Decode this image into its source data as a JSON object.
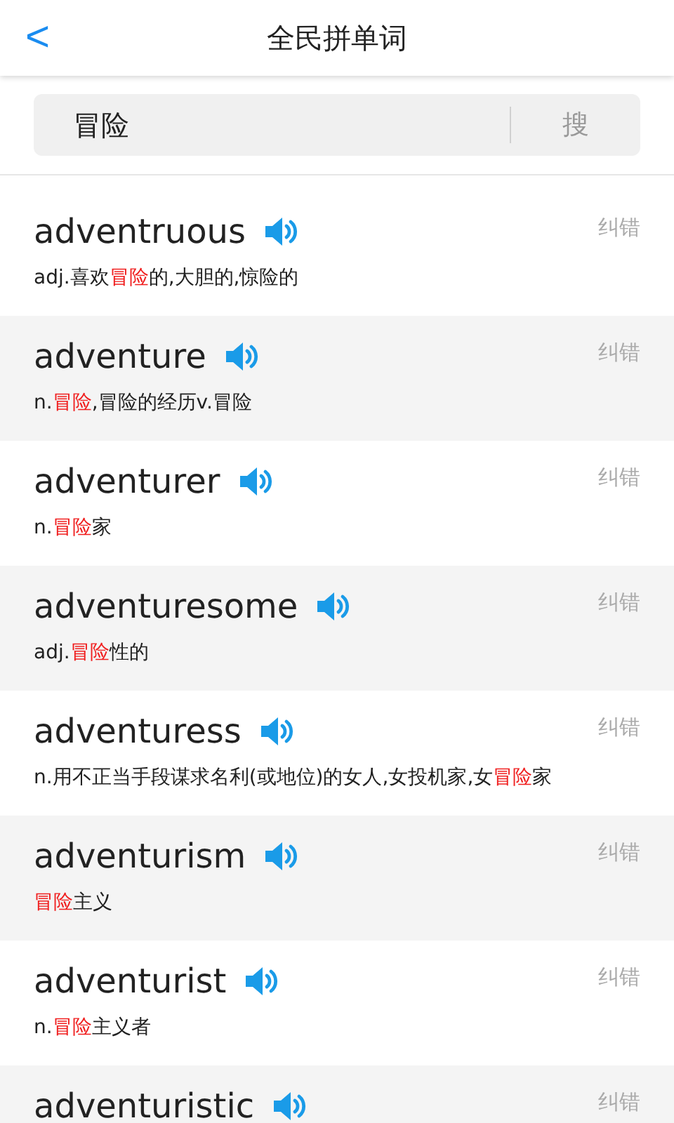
{
  "header": {
    "back": "<",
    "title": "全民拼单词"
  },
  "search": {
    "value": "冒险",
    "button": "搜"
  },
  "words": [
    {
      "word": "adventruous",
      "report": "纠错",
      "definition": [
        {
          "text": "adj.喜欢",
          "highlight": false
        },
        {
          "text": "冒险",
          "highlight": true
        },
        {
          "text": "的,大胆的,惊险的",
          "highlight": false
        }
      ]
    },
    {
      "word": "adventure",
      "report": "纠错",
      "definition": [
        {
          "text": "n.",
          "highlight": false
        },
        {
          "text": "冒险",
          "highlight": true
        },
        {
          "text": ",冒险的经历v.冒险",
          "highlight": false
        }
      ]
    },
    {
      "word": "adventurer",
      "report": "纠错",
      "definition": [
        {
          "text": "n.",
          "highlight": false
        },
        {
          "text": "冒险",
          "highlight": true
        },
        {
          "text": "家",
          "highlight": false
        }
      ]
    },
    {
      "word": "adventuresome",
      "report": "纠错",
      "definition": [
        {
          "text": "adj.",
          "highlight": false
        },
        {
          "text": "冒险",
          "highlight": true
        },
        {
          "text": "性的",
          "highlight": false
        }
      ]
    },
    {
      "word": "adventuress",
      "report": "纠错",
      "definition": [
        {
          "text": "n.用不正当手段谋求名利(或地位)的女人,女投机家,女",
          "highlight": false
        },
        {
          "text": "冒险",
          "highlight": true
        },
        {
          "text": "家",
          "highlight": false
        }
      ]
    },
    {
      "word": "adventurism",
      "report": "纠错",
      "definition": [
        {
          "text": "冒险",
          "highlight": true
        },
        {
          "text": "主义",
          "highlight": false
        }
      ]
    },
    {
      "word": "adventurist",
      "report": "纠错",
      "definition": [
        {
          "text": "n.",
          "highlight": false
        },
        {
          "text": "冒险",
          "highlight": true
        },
        {
          "text": "主义者",
          "highlight": false
        }
      ]
    },
    {
      "word": "adventuristic",
      "report": "纠错"
    }
  ]
}
